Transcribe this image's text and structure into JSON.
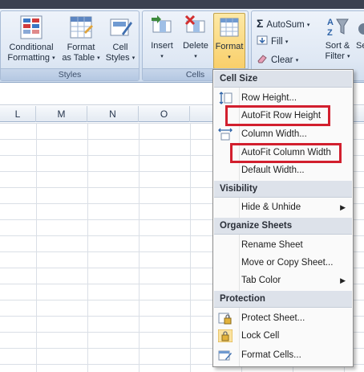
{
  "ribbon": {
    "styles_group": {
      "label": "Styles",
      "conditional_formatting": [
        "Conditional",
        "Formatting"
      ],
      "format_as_table": [
        "Format",
        "as Table"
      ],
      "cell_styles": [
        "Cell",
        "Styles"
      ]
    },
    "cells_group": {
      "label": "Cells",
      "insert": "Insert",
      "delete": "Delete",
      "format": "Format"
    },
    "editing_group": {
      "autosum": "AutoSum",
      "fill": "Fill",
      "clear": "Clear",
      "sort_filter": [
        "Sort &",
        "Filter"
      ],
      "find_select_partial": [
        "",
        "Se"
      ]
    }
  },
  "sheet": {
    "columns": [
      "L",
      "M",
      "N",
      "O"
    ]
  },
  "menu": {
    "cell_size": {
      "header": "Cell Size",
      "items": [
        "Row Height...",
        "AutoFit Row Height",
        "Column Width...",
        "AutoFit Column Width",
        "Default Width..."
      ]
    },
    "visibility": {
      "header": "Visibility",
      "items": [
        "Hide & Unhide"
      ]
    },
    "organize": {
      "header": "Organize Sheets",
      "items": [
        "Rename Sheet",
        "Move or Copy Sheet...",
        "Tab Color"
      ]
    },
    "protection": {
      "header": "Protection",
      "items": [
        "Protect Sheet...",
        "Lock Cell",
        "Format Cells..."
      ]
    },
    "highlight_color": "#d21f2e"
  },
  "icons": {
    "submenu_arrow": "▶",
    "dropdown_arrow": "▾",
    "sigma": "Σ"
  }
}
